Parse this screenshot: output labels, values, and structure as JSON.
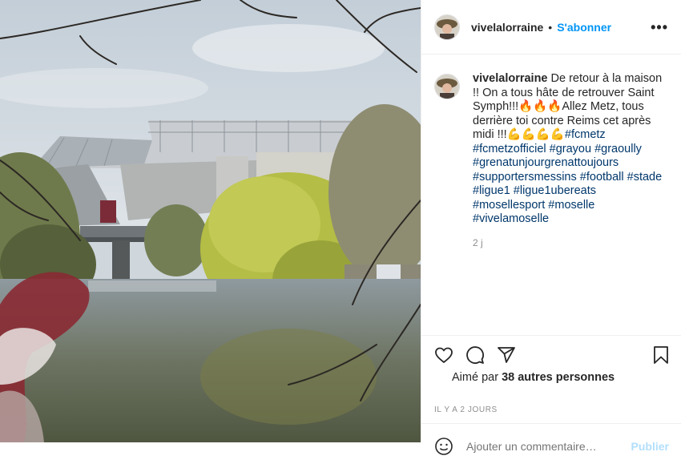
{
  "post": {
    "username": "vivelalorraine",
    "follow_label": "S'abonner",
    "dot": "•",
    "more_label": "•••"
  },
  "caption": {
    "username": "vivelalorraine",
    "text": "De retour à la maison !! On a tous hâte de retrouver Saint Symph!!!🔥🔥🔥Allez Metz, tous derrière toi contre Reims cet après midi !!!💪💪💪💪",
    "hashtags": [
      "#fcmetz",
      "#fcmetzofficiel",
      "#grayou",
      "#graoully",
      "#grenatunjourgrenattoujours",
      "#supportersmessins",
      "#football",
      "#stade",
      "#ligue1",
      "#ligue1ubereats",
      "#mosellesport",
      "#moselle",
      "#vivelamoselle"
    ],
    "time_short": "2 j"
  },
  "likes": {
    "prefix": "Aimé par",
    "count_text": "38 autres personnes"
  },
  "posted_ago": "IL Y A 2 JOURS",
  "comment": {
    "placeholder": "Ajouter un commentaire…",
    "publish_label": "Publier"
  },
  "icons": [
    "heart-icon",
    "comment-icon",
    "share-icon",
    "bookmark-icon",
    "more-options-icon",
    "emoji-icon"
  ],
  "colors": {
    "accent": "#0095f6",
    "hashtag": "#00376b",
    "muted": "#8e8e8e",
    "publish_disabled": "#b2dffc"
  }
}
